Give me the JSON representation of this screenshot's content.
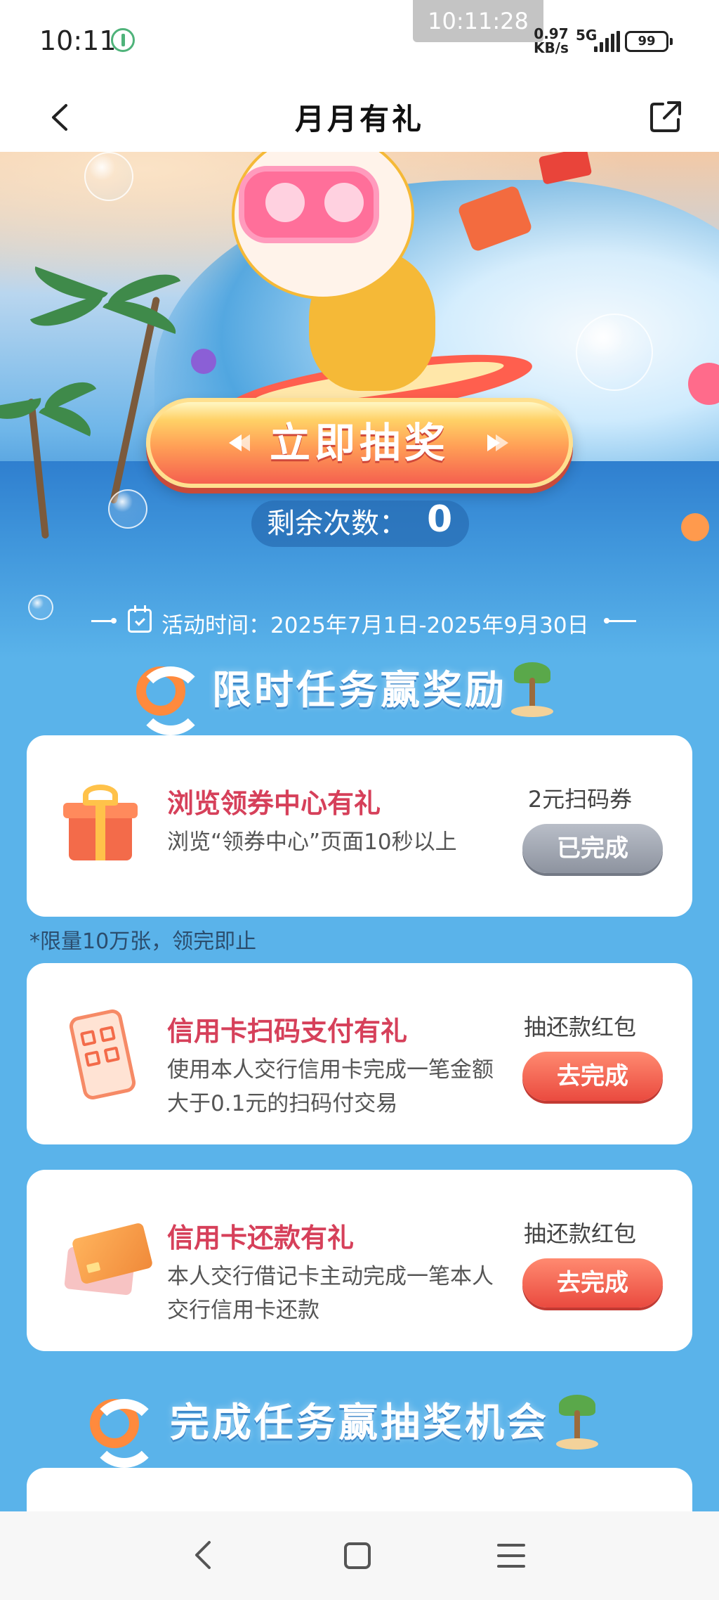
{
  "status_bar": {
    "time": "10:11",
    "clock_overlay": "10:11:28",
    "network_speed_value": "0.97",
    "network_speed_unit": "KB/s",
    "network_type": "5G",
    "battery": "99"
  },
  "nav": {
    "title": "月月有礼"
  },
  "hero": {
    "draw_button_label": "立即抽奖",
    "remaining_label": "剩余次数：",
    "remaining_count": "0"
  },
  "activity": {
    "time_text": "活动时间：2025年7月1日-2025年9月30日"
  },
  "sections": {
    "limited_tasks_title": "限时任务赢奖励",
    "lottery_tasks_title": "完成任务赢抽奖机会"
  },
  "tasks": [
    {
      "title": "浏览领券中心有礼",
      "desc": "浏览“领券中心”页面10秒以上",
      "reward": "2元扫码券",
      "button": "已完成",
      "icon": "gift-icon"
    },
    {
      "title": "信用卡扫码支付有礼",
      "desc": "使用本人交行信用卡完成一笔金额大于0.1元的扫码付交易",
      "reward": "抽还款红包",
      "button": "去完成",
      "icon": "qr-phone-icon"
    },
    {
      "title": "信用卡还款有礼",
      "desc": "本人交行借记卡主动完成一笔本人交行信用卡还款",
      "reward": "抽还款红包",
      "button": "去完成",
      "icon": "credit-card-icon"
    }
  ],
  "limit_note": "*限量10万张，领完即止",
  "colors": {
    "background": "#5ab3ea",
    "task_title": "#d6405a",
    "button_go": "#ea4a3f",
    "button_done": "#8d939f"
  }
}
